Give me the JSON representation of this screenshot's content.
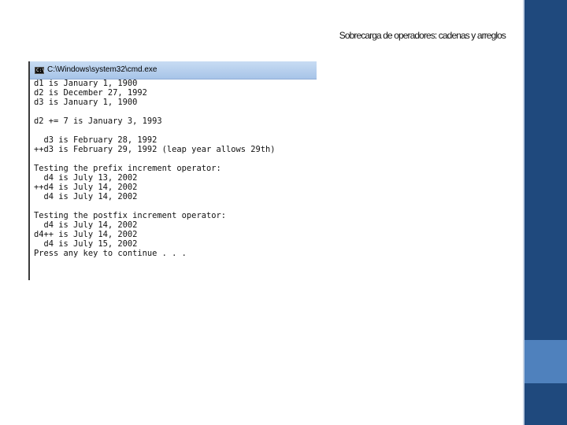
{
  "slide": {
    "title": "Sobrecarga de operadores: cadenas y arreglos"
  },
  "window": {
    "title": "C:\\Windows\\system32\\cmd.exe",
    "icon": "cmd-icon",
    "icon_glyph": "C:\\"
  },
  "console_lines": [
    "d1 is January 1, 1900",
    "d2 is December 27, 1992",
    "d3 is January 1, 1900",
    "",
    "d2 += 7 is January 3, 1993",
    "",
    "  d3 is February 28, 1992",
    "++d3 is February 29, 1992 (leap year allows 29th)",
    "",
    "Testing the prefix increment operator:",
    "  d4 is July 13, 2002",
    "++d4 is July 14, 2002",
    "  d4 is July 14, 2002",
    "",
    "Testing the postfix increment operator:",
    "  d4 is July 14, 2002",
    "d4++ is July 14, 2002",
    "  d4 is July 15, 2002",
    "Press any key to continue . . ."
  ],
  "colors": {
    "sidebar": "#1f497d",
    "sidebar_accent": "#4f81bd",
    "titlebar": "#a7c4e8"
  }
}
